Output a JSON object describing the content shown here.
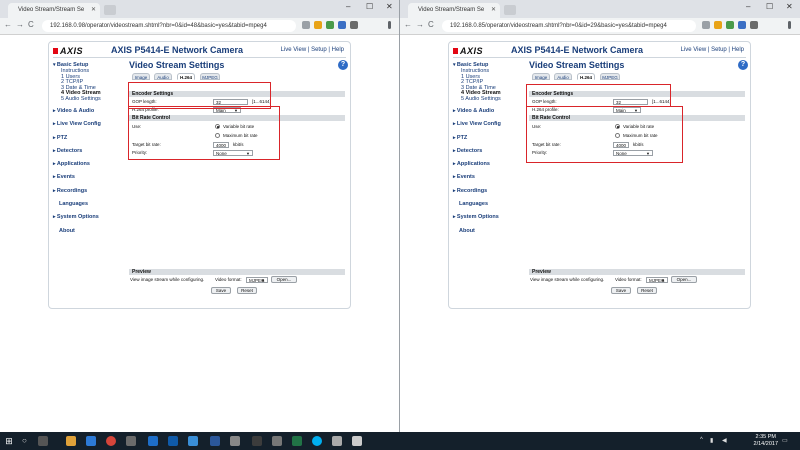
{
  "browser": {
    "tab_title": "Video Stream/Stream Se",
    "tab_close": "✕",
    "nav": {
      "back": "←",
      "forward": "→",
      "reload": "C"
    },
    "window_controls": {
      "minimize": "–",
      "maximize": "☐",
      "close": "✕"
    }
  },
  "left": {
    "url": "192.168.0.98/operator/videostream.shtml?nbr=0&id=48&basic=yes&tabid=mpeg4",
    "gop_value": "32"
  },
  "right": {
    "url": "192.168.0.85/operator/videostream.shtml?nbr=0&id=29&basic=yes&tabid=mpeg4",
    "gop_value": "32"
  },
  "camera": {
    "logo": "AXIS",
    "model": "AXIS P5414-E Network Camera",
    "links": [
      "Live View",
      "Setup",
      "Help"
    ],
    "link_separator": " | "
  },
  "sidebar": {
    "basic_setup": "Basic Setup",
    "sub_items": [
      "Instructions",
      "1 Users",
      "2 TCP/IP",
      "3 Date & Time",
      "4 Video Stream",
      "5 Audio Settings"
    ],
    "groups": [
      "Video & Audio",
      "Live View Config",
      "PTZ",
      "Detectors",
      "Applications",
      "Events",
      "Recordings",
      "Languages",
      "System Options",
      "About"
    ]
  },
  "page": {
    "title": "Video Stream Settings",
    "help": "?",
    "tabs": [
      "Image",
      "Audio",
      "H.264",
      "MJPEG"
    ],
    "selected_tab": "H.264"
  },
  "encoder": {
    "heading": "Encoder Settings",
    "gop_label": "GOP length:",
    "gop_range": "[1...6144]",
    "profile_label": "H.264 profile:",
    "profile_value": "Main"
  },
  "bitrate": {
    "heading": "Bit Rate Control",
    "use_label": "Use:",
    "option_variable": "Variable bit rate",
    "option_maximum": "Maximum bit rate",
    "target_label": "Target bit rate:",
    "target_value": "4000",
    "target_unit": "kbit/s",
    "priority_label": "Priority:",
    "priority_value": "None"
  },
  "preview": {
    "heading": "Preview",
    "text": "View image stream while configuring.",
    "format_label": "Video format:",
    "format_value": "MJPEG",
    "open_button": "Open...",
    "save_button": "Save",
    "reset_button": "Reset"
  },
  "taskbar": {
    "time": "2:35 PM",
    "date": "2/14/2017",
    "colors": {
      "bar": "#14202b",
      "accent_red": "#d9252a",
      "link_blue": "#1a3e7a"
    }
  }
}
